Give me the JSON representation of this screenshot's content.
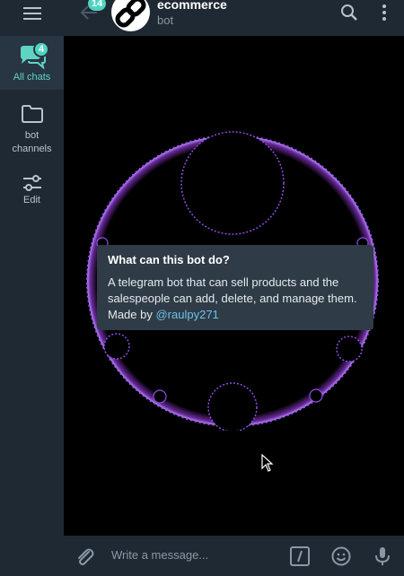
{
  "sidebar": {
    "folders": [
      {
        "label": "All chats",
        "badge": "4"
      },
      {
        "label": "bot channels"
      },
      {
        "label": "Edit"
      }
    ]
  },
  "header": {
    "unread_count": "14",
    "title": "ecommerce",
    "subtitle": "bot"
  },
  "bot_info": {
    "heading": "What can this bot do?",
    "description": "A telegram bot that can sell products and the salespeople can add, delete, and manage them. Made by ",
    "mention": "@raulpy271"
  },
  "composer": {
    "placeholder": "Write a message..."
  },
  "colors": {
    "accent": "#4fd3c2",
    "link": "#6bc2e8",
    "panel": "#1f2933",
    "card": "#2f3b47"
  }
}
